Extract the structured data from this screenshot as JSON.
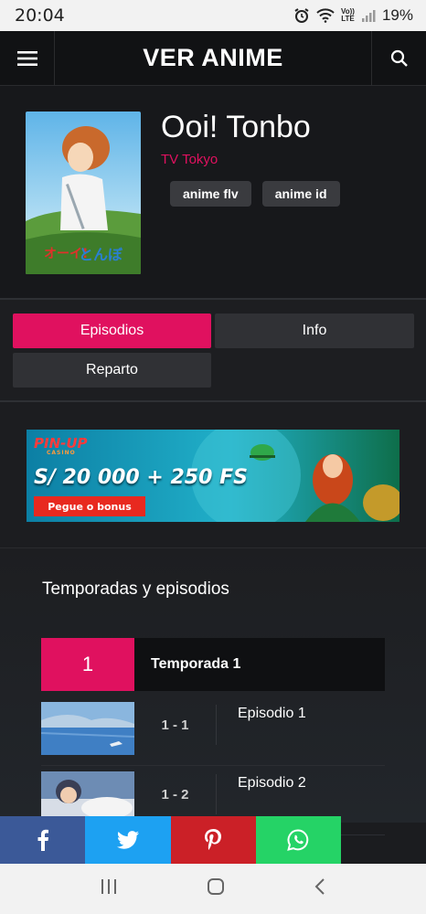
{
  "status": {
    "time": "20:04",
    "battery": "19%",
    "volte_top": "Vo))",
    "volte_bottom": "LTE"
  },
  "header": {
    "title": "VER ANIME"
  },
  "anime": {
    "title": "Ooi! Tonbo",
    "studio": "TV Tokyo",
    "tags": [
      "anime flv",
      "anime id"
    ]
  },
  "tabs": {
    "episodes": "Episodios",
    "info": "Info",
    "cast": "Reparto"
  },
  "ad": {
    "brand": "PIN-UP",
    "brand_sub": "CASINO",
    "offer": "S/ 20 000 + 250 FS",
    "cta": "Pegue o bonus"
  },
  "seasons": {
    "title": "Temporadas y episodios",
    "season_number": "1",
    "season_label": "Temporada 1",
    "episodes": [
      {
        "code": "1 - 1",
        "name": "Episodio 1"
      },
      {
        "code": "1 - 2",
        "name": "Episodio 2"
      }
    ]
  },
  "colors": {
    "accent": "#e0115f",
    "facebook": "#3b5998",
    "twitter": "#1da1f2",
    "pinterest": "#cb2027",
    "whatsapp": "#25d366"
  }
}
